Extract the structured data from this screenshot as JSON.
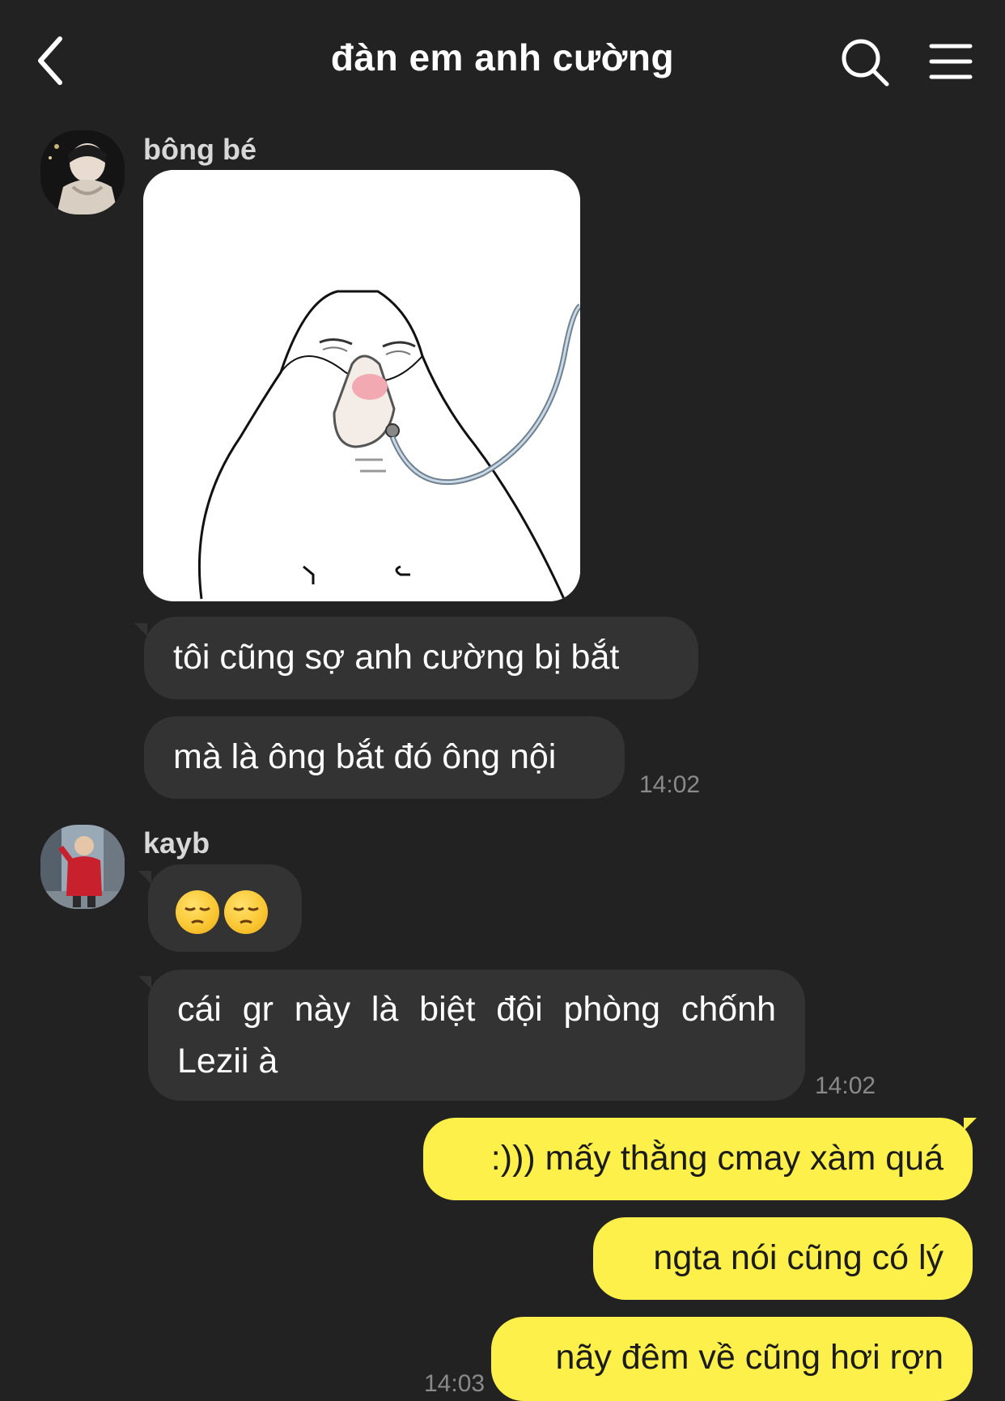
{
  "header": {
    "title": "đàn em anh cường"
  },
  "messages": [
    {
      "sender": "bông bé",
      "sticker": "oxygen-mask-blob-sticker",
      "bubbles": [
        "tôi cũng sợ anh cường bị bắt",
        "mà là ông bắt đó ông nội"
      ],
      "time": "14:02"
    },
    {
      "sender": "kayb",
      "bubbles": [
        "😔😔",
        "cái gr này là biệt đội phòng chốnh Lezii à"
      ],
      "bubble2_lines": [
        "cái gr này là biệt đội phòng chốnh",
        "Lezii à"
      ],
      "time": "14:02"
    },
    {
      "sender": "me",
      "bubbles": [
        ":))) mấy thằng cmay xàm quá",
        "ngta nói cũng có lý",
        "nãy đêm về cũng hơi rợn"
      ],
      "time": "14:03"
    }
  ],
  "icons": {
    "back": "chevron-left-icon",
    "search": "search-icon",
    "menu": "hamburger-menu-icon"
  },
  "colors": {
    "background": "#222222",
    "incoming_bubble": "#333333",
    "outgoing_bubble": "#fdf04a",
    "timestamp": "#8a8a8a"
  }
}
